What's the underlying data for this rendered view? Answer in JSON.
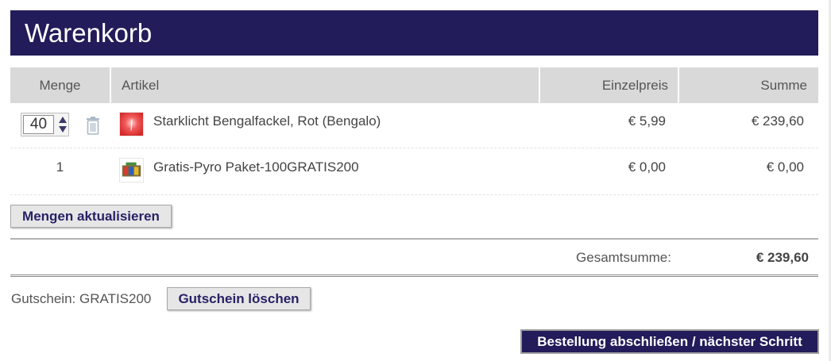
{
  "header": {
    "title": "Warenkorb"
  },
  "table": {
    "columns": {
      "quantity": "Menge",
      "article": "Artikel",
      "unit_price": "Einzelpreis",
      "total": "Summe"
    },
    "rows": [
      {
        "quantity": "40",
        "article": "Starklicht Bengalfackel, Rot (Bengalo)",
        "unit_price": "€ 5,99",
        "total": "€ 239,60",
        "editable": true,
        "thumbnail_icon": "red-flare-icon"
      },
      {
        "quantity": "1",
        "article": "Gratis-Pyro Paket-100GRATIS200",
        "unit_price": "€ 0,00",
        "total": "€ 0,00",
        "editable": false,
        "thumbnail_icon": "fireworks-package-icon"
      }
    ]
  },
  "actions": {
    "update_quantities": "Mengen aktualisieren",
    "delete_coupon": "Gutschein löschen",
    "checkout": "Bestellung abschließen / nächster Schritt"
  },
  "totals": {
    "label": "Gesamtsumme:",
    "value": "€ 239,60"
  },
  "coupon": {
    "label": "Gutschein: GRATIS200"
  },
  "colors": {
    "brand": "#221c5a",
    "header_bg": "#d9d9d9",
    "button_text": "#272266"
  }
}
